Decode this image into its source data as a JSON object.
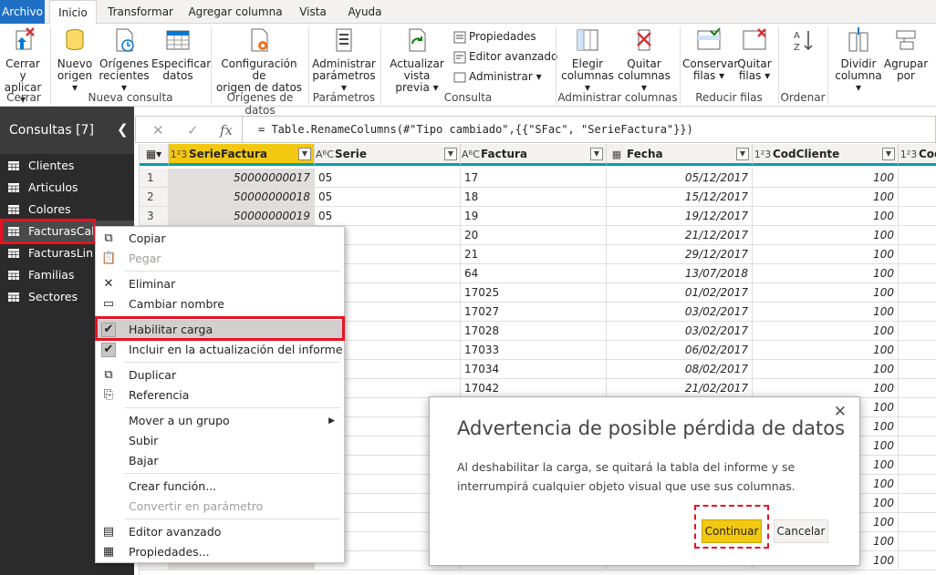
{
  "tabs": [
    "Archivo",
    "Inicio",
    "Transformar",
    "Agregar columna",
    "Vista",
    "Ayuda"
  ],
  "ribbon": {
    "close_apply": [
      "Cerrar y",
      "aplicar"
    ],
    "new_source": [
      "Nuevo",
      "origen"
    ],
    "recent_sources": [
      "Orígenes",
      "recientes"
    ],
    "enter_data": [
      "Especificar",
      "datos"
    ],
    "source_settings": [
      "Configuración de",
      "origen de datos"
    ],
    "manage_params": [
      "Administrar",
      "parámetros"
    ],
    "refresh_preview": [
      "Actualizar",
      "vista previa"
    ],
    "properties": "Propiedades",
    "advanced_editor": "Editor avanzado",
    "manage": "Administrar",
    "choose_columns": [
      "Elegir",
      "columnas"
    ],
    "remove_columns": [
      "Quitar",
      "columnas"
    ],
    "keep_rows": [
      "Conservar",
      "filas"
    ],
    "remove_rows": [
      "Quitar",
      "filas"
    ],
    "split_column": [
      "Dividir",
      "columna"
    ],
    "group_by": [
      "Agrupar",
      "por"
    ],
    "groups": {
      "close": "Cerrar",
      "new_query": "Nueva consulta",
      "data_sources": "Orígenes de datos",
      "parameters": "Parámetros",
      "query": "Consulta",
      "manage_columns": "Administrar columnas",
      "reduce_rows": "Reducir filas",
      "sort": "Ordenar"
    }
  },
  "sidebar": {
    "title": "Consultas [7]",
    "items": [
      "Clientes",
      "Articulos",
      "Colores",
      "FacturasCab",
      "FacturasLin",
      "Familias",
      "Sectores"
    ]
  },
  "formula": {
    "fx": "fx",
    "text": "= Table.RenameColumns(#\"Tipo cambiado\",{{\"SFac\", \"SerieFactura\"}})"
  },
  "grid": {
    "columns": [
      {
        "type": "1²3",
        "name": "SerieFactura"
      },
      {
        "type": "AᴮC",
        "name": "Serie"
      },
      {
        "type": "AᴮC",
        "name": "Factura"
      },
      {
        "type": "▦",
        "name": "Fecha"
      },
      {
        "type": "1²3",
        "name": "CodCliente"
      },
      {
        "type": "1²3",
        "name": "Cod"
      }
    ],
    "rows": [
      {
        "i": "1",
        "sf": "50000000017",
        "serie": "05",
        "fac": "17",
        "fecha": "05/12/2017",
        "cli": "100"
      },
      {
        "i": "2",
        "sf": "50000000018",
        "serie": "05",
        "fac": "18",
        "fecha": "15/12/2017",
        "cli": "100"
      },
      {
        "i": "3",
        "sf": "50000000019",
        "serie": "05",
        "fac": "19",
        "fecha": "19/12/2017",
        "cli": "100"
      },
      {
        "i": "",
        "sf": "",
        "serie": "",
        "fac": "20",
        "fecha": "21/12/2017",
        "cli": "100"
      },
      {
        "i": "",
        "sf": "",
        "serie": "",
        "fac": "21",
        "fecha": "29/12/2017",
        "cli": "100"
      },
      {
        "i": "",
        "sf": "",
        "serie": "",
        "fac": "64",
        "fecha": "13/07/2018",
        "cli": "100"
      },
      {
        "i": "",
        "sf": "",
        "serie": "",
        "fac": "17025",
        "fecha": "01/02/2017",
        "cli": "100"
      },
      {
        "i": "",
        "sf": "",
        "serie": "",
        "fac": "17027",
        "fecha": "03/02/2017",
        "cli": "100"
      },
      {
        "i": "",
        "sf": "",
        "serie": "",
        "fac": "17028",
        "fecha": "03/02/2017",
        "cli": "100"
      },
      {
        "i": "",
        "sf": "",
        "serie": "",
        "fac": "17033",
        "fecha": "06/02/2017",
        "cli": "100"
      },
      {
        "i": "",
        "sf": "",
        "serie": "",
        "fac": "17034",
        "fecha": "08/02/2017",
        "cli": "100"
      },
      {
        "i": "",
        "sf": "",
        "serie": "",
        "fac": "17042",
        "fecha": "21/02/2017",
        "cli": "100"
      },
      {
        "i": "",
        "sf": "",
        "serie": "",
        "fac": "",
        "fecha": "",
        "cli": "100"
      },
      {
        "i": "",
        "sf": "",
        "serie": "",
        "fac": "",
        "fecha": "",
        "cli": "100"
      },
      {
        "i": "",
        "sf": "",
        "serie": "",
        "fac": "",
        "fecha": "",
        "cli": "100"
      },
      {
        "i": "",
        "sf": "",
        "serie": "",
        "fac": "",
        "fecha": "",
        "cli": "100"
      },
      {
        "i": "",
        "sf": "",
        "serie": "",
        "fac": "",
        "fecha": "",
        "cli": "100"
      },
      {
        "i": "",
        "sf": "",
        "serie": "",
        "fac": "",
        "fecha": "",
        "cli": "100"
      },
      {
        "i": "",
        "sf": "",
        "serie": "",
        "fac": "",
        "fecha": "",
        "cli": "100"
      },
      {
        "i": "",
        "sf": "",
        "serie": "",
        "fac": "",
        "fecha": "",
        "cli": "100"
      },
      {
        "i": "",
        "sf": "",
        "serie": "",
        "fac": "",
        "fecha": "",
        "cli": "100"
      }
    ]
  },
  "context_menu": {
    "copy": "Copiar",
    "paste": "Pegar",
    "delete": "Eliminar",
    "rename": "Cambiar nombre",
    "enable_load": "Habilitar carga",
    "include_refresh": "Incluir en la actualización del informe",
    "duplicate": "Duplicar",
    "reference": "Referencia",
    "move_group": "Mover a un grupo",
    "move_up": "Subir",
    "move_down": "Bajar",
    "create_function": "Crear función...",
    "convert_param": "Convertir en parámetro",
    "advanced_editor": "Editor avanzado",
    "properties": "Propiedades..."
  },
  "dialog": {
    "title": "Advertencia de posible pérdida de datos",
    "message": "Al deshabilitar la carga, se quitará la tabla del informe y se interrumpirá cualquier objeto visual que use sus columnas.",
    "continue": "Continuar",
    "cancel": "Cancelar"
  }
}
